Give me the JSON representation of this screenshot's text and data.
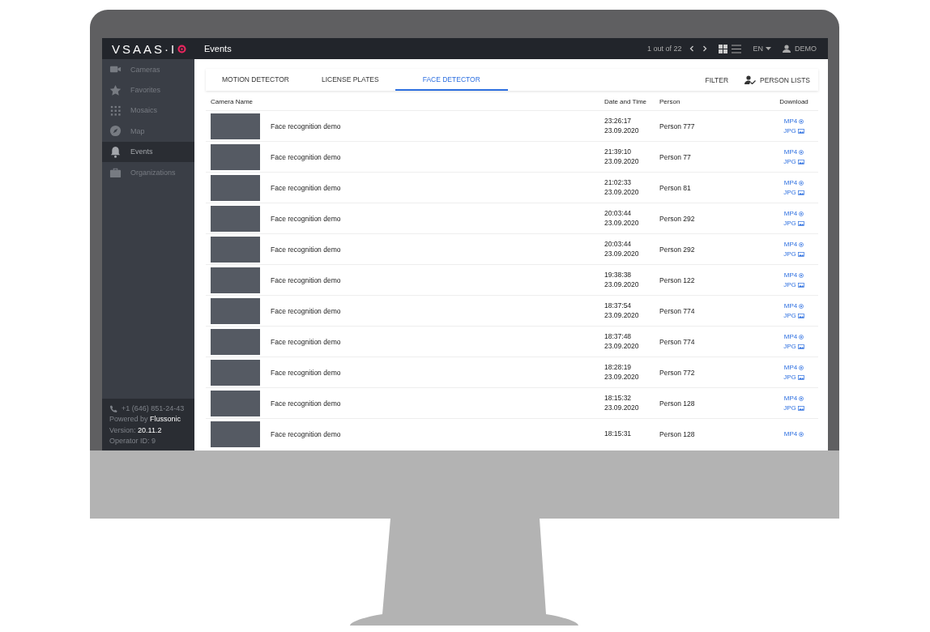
{
  "topbar": {
    "logo": "VSAAS·I",
    "title": "Events",
    "pager": "1 out of 22",
    "language": "EN",
    "user": "DEMO"
  },
  "sidebar": {
    "items": [
      {
        "label": "Cameras",
        "selected": false
      },
      {
        "label": "Favorites",
        "selected": false
      },
      {
        "label": "Mosaics",
        "selected": false
      },
      {
        "label": "Map",
        "selected": false
      },
      {
        "label": "Events",
        "selected": true
      },
      {
        "label": "Organizations",
        "selected": false
      }
    ],
    "footer": {
      "phone": "+1 (646) 851-24-43",
      "powered": "Powered by **Flussonic**",
      "version": "Version: **20.11.2**",
      "operator": "Operator ID: 9"
    }
  },
  "tabs": [
    {
      "label": "MOTION DETECTOR",
      "selected": false
    },
    {
      "label": "LICENSE PLATES",
      "selected": false
    },
    {
      "label": "FACE DETECTOR",
      "selected": true
    }
  ],
  "actions": {
    "filter": "FILTER",
    "person_lists": "PERSON LISTS"
  },
  "table": {
    "columns": [
      "Camera Name",
      "Date and Time",
      "Person",
      "Download"
    ],
    "rows": [
      {
        "camera": "Face recognition demo",
        "time": "23:26:17",
        "date": "23.09.2020",
        "person": "Person 777",
        "mp4": "MP4",
        "jpg": "JPG"
      },
      {
        "camera": "Face recognition demo",
        "time": "21:39:10",
        "date": "23.09.2020",
        "person": "Person 77",
        "mp4": "MP4",
        "jpg": "JPG"
      },
      {
        "camera": "Face recognition demo",
        "time": "21:02:33",
        "date": "23.09.2020",
        "person": "Person 81",
        "mp4": "MP4",
        "jpg": "JPG"
      },
      {
        "camera": "Face recognition demo",
        "time": "20:03:44",
        "date": "23.09.2020",
        "person": "Person 292",
        "mp4": "MP4",
        "jpg": "JPG"
      },
      {
        "camera": "Face recognition demo",
        "time": "20:03:44",
        "date": "23.09.2020",
        "person": "Person 292",
        "mp4": "MP4",
        "jpg": "JPG"
      },
      {
        "camera": "Face recognition demo",
        "time": "19:38:38",
        "date": "23.09.2020",
        "person": "Person 122",
        "mp4": "MP4",
        "jpg": "JPG"
      },
      {
        "camera": "Face recognition demo",
        "time": "18:37:54",
        "date": "23.09.2020",
        "person": "Person 774",
        "mp4": "MP4",
        "jpg": "JPG"
      },
      {
        "camera": "Face recognition demo",
        "time": "18:37:48",
        "date": "23.09.2020",
        "person": "Person 774",
        "mp4": "MP4",
        "jpg": "JPG"
      },
      {
        "camera": "Face recognition demo",
        "time": "18:28:19",
        "date": "23.09.2020",
        "person": "Person 772",
        "mp4": "MP4",
        "jpg": "JPG"
      },
      {
        "camera": "Face recognition demo",
        "time": "18:15:32",
        "date": "23.09.2020",
        "person": "Person 128",
        "mp4": "MP4",
        "jpg": "JPG"
      },
      {
        "camera": "Face recognition demo",
        "time": "18:15:31",
        "person": "Person 128",
        "mp4": "MP4"
      }
    ]
  }
}
